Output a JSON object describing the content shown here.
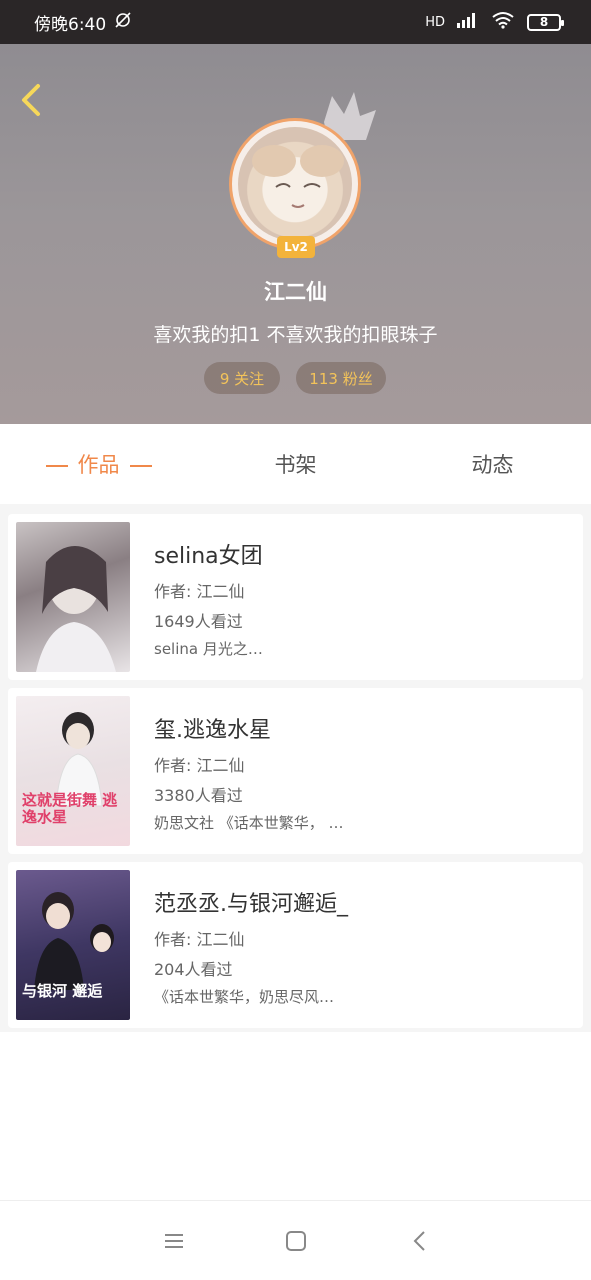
{
  "status_bar": {
    "time": "傍晚6:40",
    "network": "HD",
    "battery": "8"
  },
  "profile": {
    "level": "Lv2",
    "name": "江二仙",
    "bio": "喜欢我的扣1 不喜欢我的扣眼珠子",
    "follow_label": "9 关注",
    "fans_label": "113 粉丝"
  },
  "tabs": [
    {
      "label": "作品",
      "active": true
    },
    {
      "label": "书架",
      "active": false
    },
    {
      "label": "动态",
      "active": false
    }
  ],
  "books": [
    {
      "title": "selina女团",
      "author": "作者: 江二仙",
      "views": "1649人看过",
      "desc": "selina 月光之…",
      "cover_text": ""
    },
    {
      "title": "玺.逃逸水星",
      "author": "作者: 江二仙",
      "views": "3380人看过",
      "desc": "奶思文社 《话本世繁华， …",
      "cover_text": "这就是街舞 逃逸水星"
    },
    {
      "title": "范丞丞.与银河邂逅_",
      "author": "作者: 江二仙",
      "views": "204人看过",
      "desc": "《话本世繁华，奶思尽风…",
      "cover_text": "与银河 邂逅"
    }
  ],
  "colors": {
    "accent": "#f0884a",
    "level_badge": "#f3b33b",
    "stat_text": "#f3c35a"
  }
}
